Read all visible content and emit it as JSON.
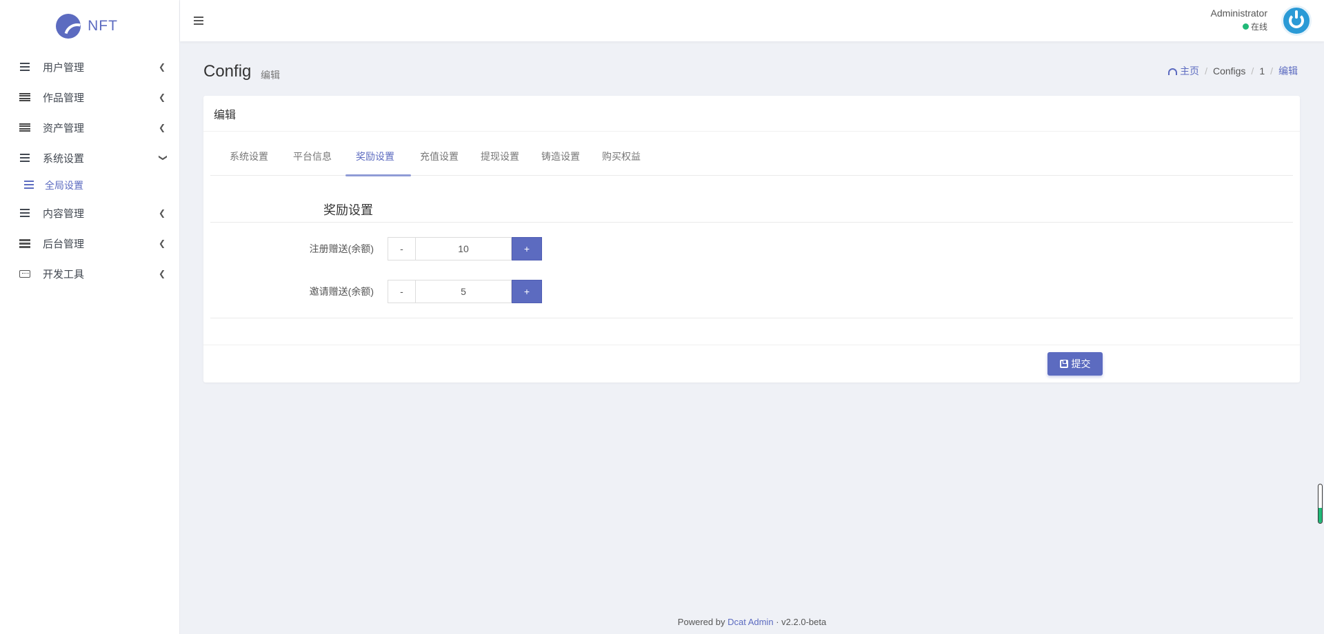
{
  "brand": {
    "name": "NFT"
  },
  "sidebar": {
    "items": [
      {
        "label": "用户管理",
        "icon": "bars-icon"
      },
      {
        "label": "作品管理",
        "icon": "table-icon"
      },
      {
        "label": "资产管理",
        "icon": "table-icon"
      },
      {
        "label": "系统设置",
        "icon": "bars-icon",
        "expanded": true
      },
      {
        "label": "内容管理",
        "icon": "bars-icon"
      },
      {
        "label": "后台管理",
        "icon": "server-icon"
      },
      {
        "label": "开发工具",
        "icon": "keyboard-icon"
      }
    ],
    "sub_items": [
      {
        "label": "全局设置",
        "icon": "bars-icon",
        "active": true
      }
    ]
  },
  "topbar": {
    "user_name": "Administrator",
    "user_status": "在线"
  },
  "header": {
    "title": "Config",
    "subtitle": "编辑",
    "breadcrumb": {
      "home": "主页",
      "configs": "Configs",
      "id": "1",
      "current": "编辑"
    }
  },
  "card": {
    "title": "编辑",
    "tabs": [
      {
        "label": "系统设置"
      },
      {
        "label": "平台信息"
      },
      {
        "label": "奖励设置",
        "active": true
      },
      {
        "label": "充值设置"
      },
      {
        "label": "提现设置"
      },
      {
        "label": "铸造设置"
      },
      {
        "label": "购买权益"
      }
    ],
    "section_title": "奖励设置",
    "fields": [
      {
        "label": "注册赠送(余额)",
        "value": "10",
        "minus": "-",
        "plus": "+"
      },
      {
        "label": "邀请赠送(余额)",
        "value": "5",
        "minus": "-",
        "plus": "+"
      }
    ],
    "submit_label": "提交"
  },
  "footer": {
    "prefix": "Powered by",
    "link": "Dcat Admin",
    "separator": "·",
    "version": "v2.2.0-beta"
  },
  "colors": {
    "primary": "#5c6bc0",
    "online": "#21b978",
    "background": "#eff1f6"
  },
  "scroll_indicator": {
    "fill_fraction": 0.4
  }
}
